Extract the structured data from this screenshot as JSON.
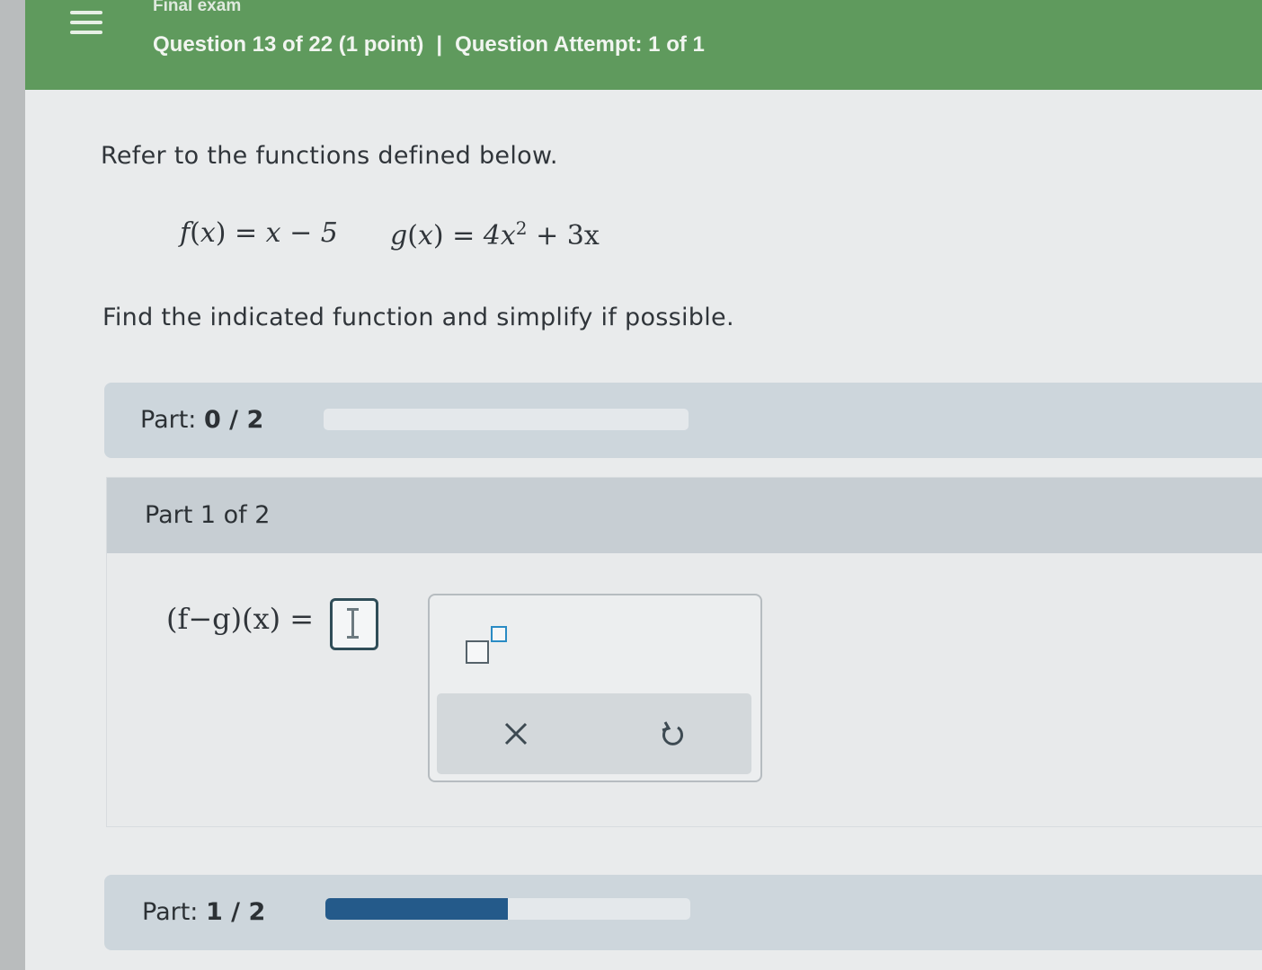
{
  "header": {
    "exam_title": "Final exam",
    "question_info": "Question 13 of 22 (1 point)",
    "separator": "|",
    "attempt_info": "Question Attempt: 1 of 1",
    "bg_color": "#5f9a5d"
  },
  "problem": {
    "intro": "Refer to the functions defined below.",
    "f_def": {
      "name": "f",
      "arg": "x",
      "rhs": "x − 5"
    },
    "g_def": {
      "name": "g",
      "arg": "x",
      "rhs_a": "4x",
      "exponent": "2",
      "rhs_b": "+ 3x"
    },
    "instruction": "Find the indicated function and simplify if possible."
  },
  "progress_top": {
    "label": "Part:",
    "value": "0 / 2",
    "fraction": 0.0
  },
  "part1": {
    "title": "Part 1 of 2",
    "lhs": "(f−g)(x) =",
    "answer_value": "",
    "palette": {
      "exponent_icon": "superscript-template-icon",
      "clear_icon": "close-icon",
      "undo_icon": "undo-icon"
    }
  },
  "progress_bottom": {
    "label": "Part:",
    "value": "1 / 2",
    "fraction": 0.5,
    "fill_color": "#245a8a"
  }
}
